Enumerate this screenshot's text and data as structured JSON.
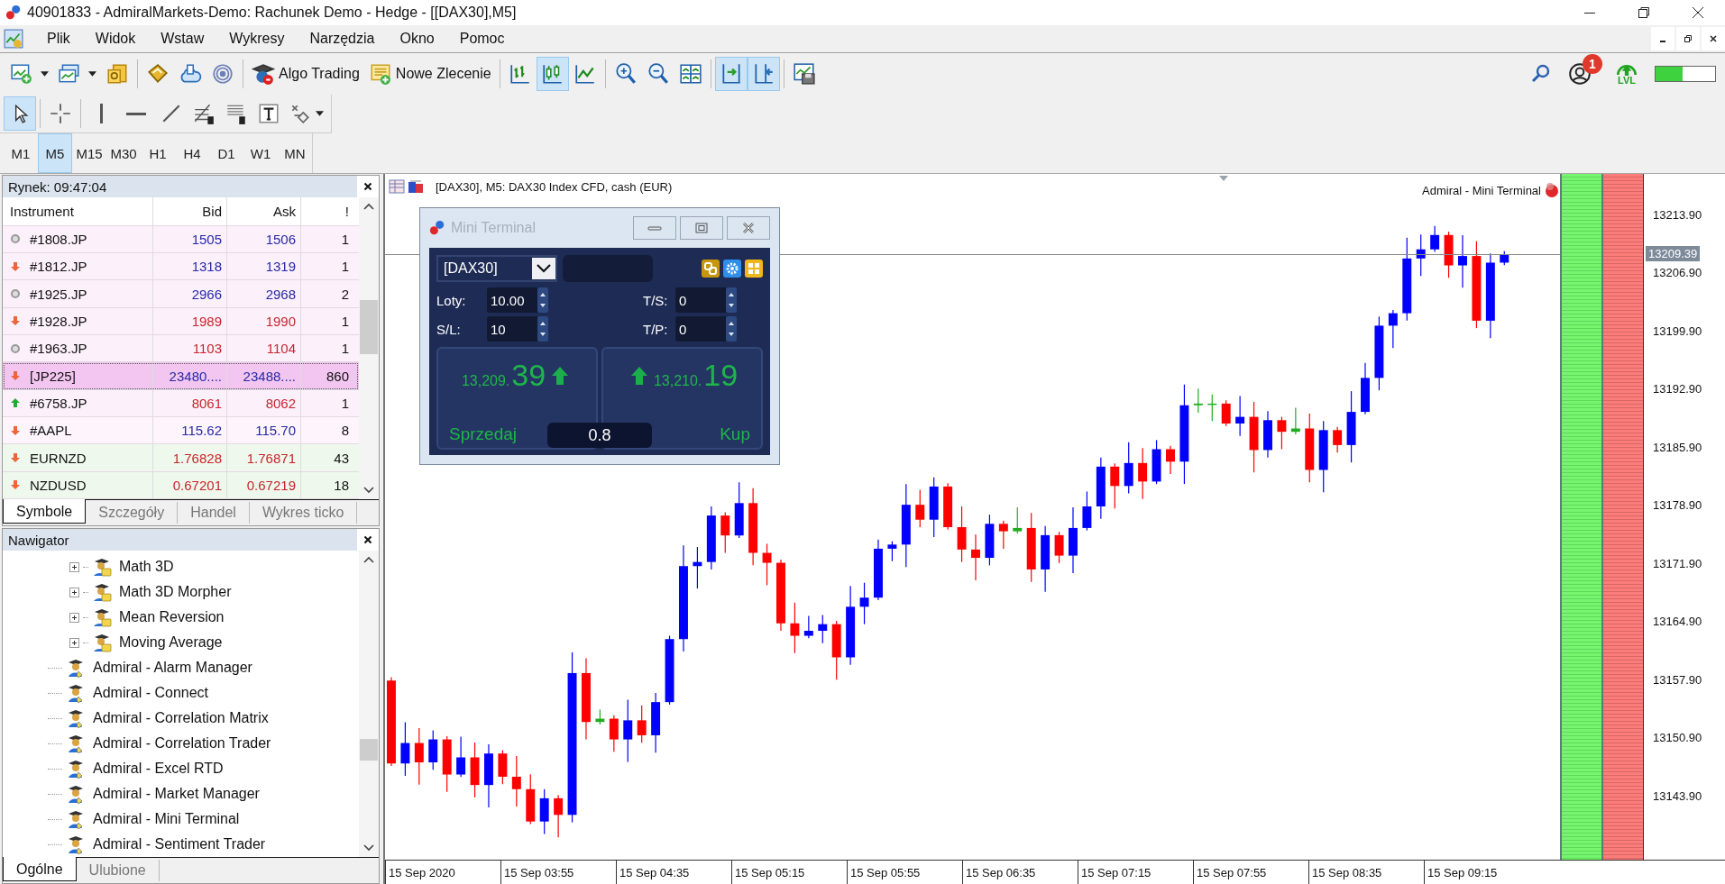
{
  "window": {
    "title": "40901833 - AdmiralMarkets-Demo: Rachunek Demo - Hedge - [[DAX30],M5]"
  },
  "menu": [
    "Plik",
    "Widok",
    "Wstaw",
    "Wykresy",
    "Narzędzia",
    "Okno",
    "Pomoc"
  ],
  "toolbar": [
    {
      "pressed": false
    },
    {
      "pressed": false
    },
    {
      "pressed": false
    },
    {
      "pressed": false
    },
    {
      "pressed": false
    },
    {
      "pressed": false
    },
    {
      "label": "Algo Trading",
      "pressed": false
    },
    {
      "label": "Nowe Zlecenie",
      "pressed": false
    },
    {
      "pressed": false
    },
    {
      "pressed": true
    },
    {
      "pressed": false
    },
    {
      "pressed": false
    },
    {
      "pressed": false
    },
    {
      "pressed": false
    },
    {
      "pressed": true
    },
    {
      "pressed": true
    },
    {
      "pressed": false
    }
  ],
  "status": {
    "notifications": "1",
    "level_label": "LVL",
    "connection": {
      "level": 0.45
    }
  },
  "drawing_tools": [
    {
      "pressed": true
    },
    {
      "pressed": false
    },
    {
      "pressed": false
    },
    {
      "pressed": false
    },
    {
      "pressed": false
    },
    {
      "pressed": false
    },
    {
      "pressed": false
    },
    {
      "pressed": false
    },
    {
      "pressed": false
    }
  ],
  "timeframes": [
    {
      "label": "M1",
      "selected": false
    },
    {
      "label": "M5",
      "selected": true
    },
    {
      "label": "M15",
      "selected": false
    },
    {
      "label": "M30",
      "selected": false
    },
    {
      "label": "H1",
      "selected": false
    },
    {
      "label": "H4",
      "selected": false
    },
    {
      "label": "D1",
      "selected": false
    },
    {
      "label": "W1",
      "selected": false
    },
    {
      "label": "MN",
      "selected": false
    }
  ],
  "market_watch": {
    "title": "Rynek: 09:47:04",
    "columns": [
      "Instrument",
      "Bid",
      "Ask",
      "!"
    ],
    "rows": [
      {
        "instrument": "#1808.JP",
        "bid": "1505",
        "ask": "1506",
        "spread": "1",
        "kind": "flat",
        "rising": true,
        "color": "#fcf0fb",
        "selected": false
      },
      {
        "instrument": "#1812.JP",
        "bid": "1318",
        "ask": "1319",
        "spread": "1",
        "kind": "down",
        "rising": true,
        "color": "#fcf0fb",
        "selected": false
      },
      {
        "instrument": "#1925.JP",
        "bid": "2966",
        "ask": "2968",
        "spread": "2",
        "kind": "flat",
        "rising": true,
        "color": "#fcf0fb",
        "selected": false
      },
      {
        "instrument": "#1928.JP",
        "bid": "1989",
        "ask": "1990",
        "spread": "1",
        "kind": "down",
        "rising": false,
        "color": "#fcf0fb",
        "selected": false
      },
      {
        "instrument": "#1963.JP",
        "bid": "1103",
        "ask": "1104",
        "spread": "1",
        "kind": "flat",
        "rising": false,
        "color": "#fcf0fb",
        "selected": false
      },
      {
        "instrument": "[JP225]",
        "bid": "23480....",
        "ask": "23488....",
        "spread": "860",
        "kind": "down",
        "rising": true,
        "color": "#f2c6f0",
        "selected": true
      },
      {
        "instrument": "#6758.JP",
        "bid": "8061",
        "ask": "8062",
        "spread": "1",
        "kind": "up",
        "rising": false,
        "color": "#fcf0fb",
        "selected": false
      },
      {
        "instrument": "#AAPL",
        "bid": "115.62",
        "ask": "115.70",
        "spread": "8",
        "kind": "down",
        "rising": true,
        "color": "#fdf4fc",
        "selected": false
      },
      {
        "instrument": "EURNZD",
        "bid": "1.76828",
        "ask": "1.76871",
        "spread": "43",
        "kind": "down",
        "rising": false,
        "color": "#eef8ec",
        "selected": false
      },
      {
        "instrument": "NZDUSD",
        "bid": "0.67201",
        "ask": "0.67219",
        "spread": "18",
        "kind": "down",
        "rising": false,
        "color": "#eef8ec",
        "selected": false
      }
    ],
    "tabs": [
      {
        "label": "Symbole",
        "selected": true
      },
      {
        "label": "Szczegóły",
        "selected": false
      },
      {
        "label": "Handel",
        "selected": false
      },
      {
        "label": "Wykres ticko",
        "selected": false
      }
    ]
  },
  "navigator": {
    "title": "Nawigator",
    "items": [
      {
        "children": [
          {
            "label": "Math 3D",
            "expanded": false
          },
          {
            "label": "Math 3D Morpher",
            "expanded": false
          },
          {
            "label": "Mean Reversion",
            "expanded": false
          },
          {
            "label": "Moving Average",
            "expanded": false
          }
        ]
      },
      {
        "label": "Admiral - Alarm Manager"
      },
      {
        "label": "Admiral - Connect"
      },
      {
        "label": "Admiral - Correlation Matrix"
      },
      {
        "label": "Admiral - Correlation Trader"
      },
      {
        "label": "Admiral - Excel RTD"
      },
      {
        "label": "Admiral - Market Manager"
      },
      {
        "label": "Admiral - Mini Terminal"
      },
      {
        "label": "Admiral - Sentiment Trader"
      }
    ],
    "tabs": [
      {
        "label": "Ogólne",
        "selected": true
      },
      {
        "label": "Ulubione",
        "selected": false
      }
    ]
  },
  "chart": {
    "title": "[DAX30], M5:  DAX30 Index CFD, cash (EUR)",
    "indicator_label": "Admiral - Mini Terminal",
    "current_price": "13209.39",
    "price_ticks": [
      "13213.90",
      "13206.90",
      "13199.90",
      "13192.90",
      "13185.90",
      "13178.90",
      "13171.90",
      "13164.90",
      "13157.90",
      "13150.90",
      "13143.90"
    ],
    "time_ticks": [
      "15 Sep 2020",
      "15 Sep 03:55",
      "15 Sep 04:35",
      "15 Sep 05:15",
      "15 Sep 05:55",
      "15 Sep 06:35",
      "15 Sep 07:15",
      "15 Sep 07:55",
      "15 Sep 08:35",
      "15 Sep 09:15"
    ]
  },
  "mini_terminal": {
    "title": "Mini Terminal",
    "symbol": "[DAX30]",
    "fields": [
      {
        "label": "Loty:",
        "value": "10.00"
      },
      {
        "label": "T/S:",
        "value": "0"
      },
      {
        "label": "S/L:",
        "value": "10"
      },
      {
        "label": "T/P:",
        "value": "0"
      }
    ],
    "sell": {
      "price": "13,209.",
      "pips": "39",
      "label": "Sprzedaj"
    },
    "buy": {
      "price": "13,210.",
      "pips": "19",
      "label": "Kup"
    },
    "spread": "0.8"
  }
}
